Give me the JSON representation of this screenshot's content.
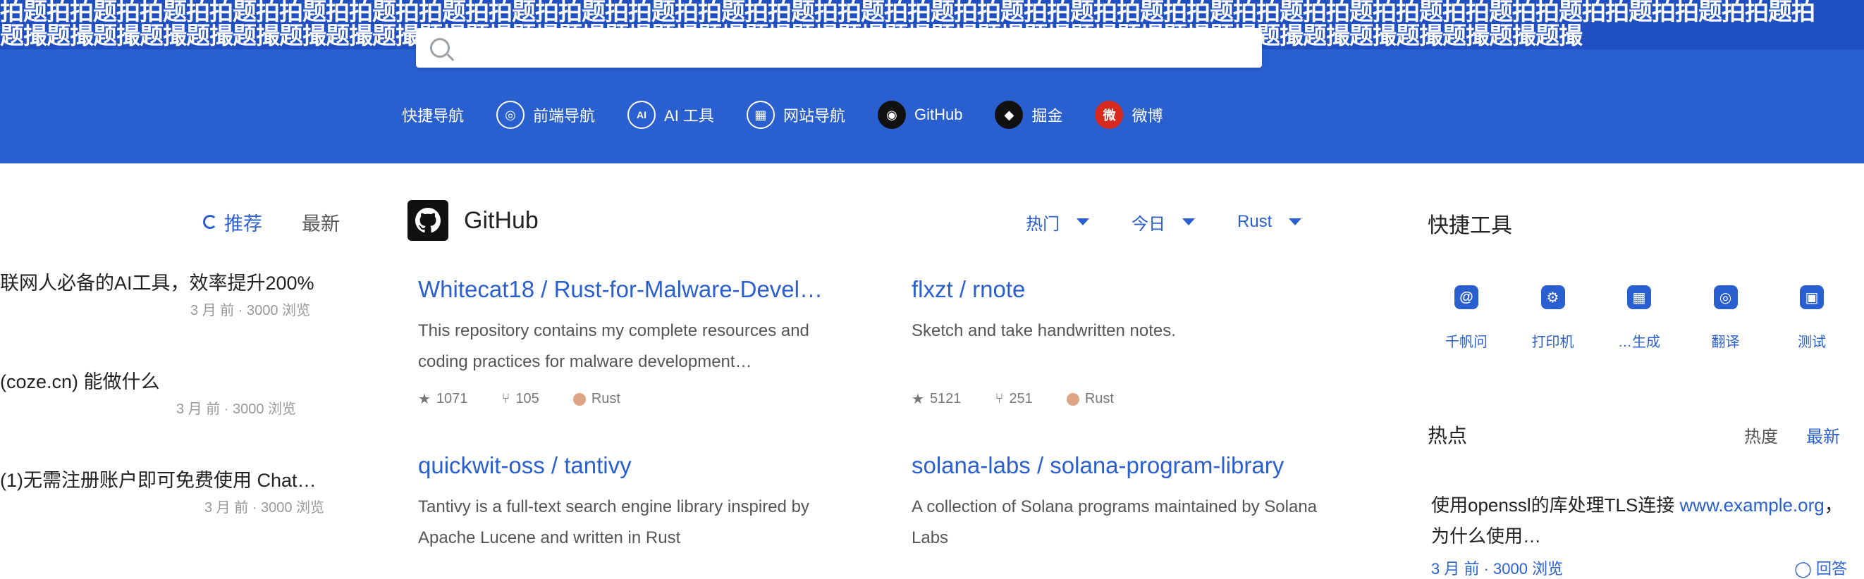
{
  "banner": {
    "stamp_text": "拍题拍拍题拍拍题拍拍题拍拍题拍拍题拍拍题拍拍题拍拍题拍拍题拍拍题拍拍题拍拍题拍拍题拍拍题拍拍题拍拍题拍拍题拍拍题拍拍题拍拍题拍拍题拍拍题拍拍题拍拍题拍拍题拍",
    "stamp_text_2": "题撮题撮题撮题撮题撮题撮题撮题撮题撮题撮题撮题撮题撮题撮题撮题撮题撮题撮题撮题撮题撮题撮题撮题撮题撮题撮题撮题撮题撮题撮题撮题撮题撮题撮",
    "colors": {
      "banner": "#2a5fcf",
      "accent": "#2a5fcf"
    }
  },
  "search": {
    "value": "",
    "placeholder": "",
    "icon": "search-icon"
  },
  "quick_links": {
    "label": "快捷导航",
    "items": [
      {
        "label": "前端导航",
        "icon": "globe-icon",
        "badge_color": "#ffffff"
      },
      {
        "label": "AI 工具",
        "icon": "ai-icon",
        "badge_color": "#ffffff"
      },
      {
        "label": "网站导航",
        "icon": "grid-icon",
        "badge_color": "#ffffff"
      },
      {
        "label": "GitHub",
        "icon": "github-icon",
        "badge_color": "#111111"
      },
      {
        "label": "掘金",
        "icon": "juejin-icon",
        "badge_color": "#111111"
      },
      {
        "label": "微博",
        "icon": "weibo-icon",
        "badge_color": "#d62b1e"
      }
    ]
  },
  "left_articles": [
    {
      "title": "联网人必备的AI工具，效率提升200%",
      "meta": "3 月 前 · 3000 浏览"
    },
    {
      "title": "(coze.cn) 能做什么",
      "meta": "3 月 前 · 3000 浏览"
    },
    {
      "title": "(1)无需注册账户即可免费使用 Chat…",
      "meta": "3 月 前 · 3000 浏览"
    }
  ],
  "tabs": [
    {
      "label": "推荐",
      "active": true
    },
    {
      "label": "最新",
      "active": false
    }
  ],
  "github": {
    "title": "GitHub"
  },
  "filters": [
    {
      "label": "热门"
    },
    {
      "label": "今日"
    },
    {
      "label": "Rust"
    }
  ],
  "repos": [
    {
      "name": "Whitecat18 / Rust-for-Malware-Devel…",
      "description": "This repository contains my complete resources and coding practices for malware development…",
      "stars": "1071",
      "forks": "105",
      "language": "Rust"
    },
    {
      "name": "flxzt / rnote",
      "description": "Sketch and take handwritten notes.",
      "stars": "5121",
      "forks": "251",
      "language": "Rust"
    },
    {
      "name": "quickwit-oss / tantivy",
      "description": "Tantivy is a full-text search engine library inspired by Apache Lucene and written in Rust",
      "stars": "",
      "forks": "",
      "language": ""
    },
    {
      "name": "solana-labs / solana-program-library",
      "description": "A collection of Solana programs maintained by Solana Labs",
      "stars": "",
      "forks": "",
      "language": ""
    }
  ],
  "tools": {
    "title": "快捷工具",
    "items": [
      {
        "label": "千帆问",
        "icon": "@"
      },
      {
        "label": "打印机",
        "icon": "⚙"
      },
      {
        "label": "…生成",
        "icon": "▦"
      },
      {
        "label": "翻译",
        "icon": "◎"
      },
      {
        "label": "测试",
        "icon": "▣"
      }
    ]
  },
  "hot": {
    "title": "热点",
    "sort_label": "热度",
    "latest_label": "最新",
    "item_text": "使用openssl的库处理TLS连接 ",
    "item_link": "www.example.org",
    "item_suffix": "，为什么使用…",
    "meta_left": "3 月 前 · 3000 浏览",
    "meta_right": "◯ 回答"
  }
}
